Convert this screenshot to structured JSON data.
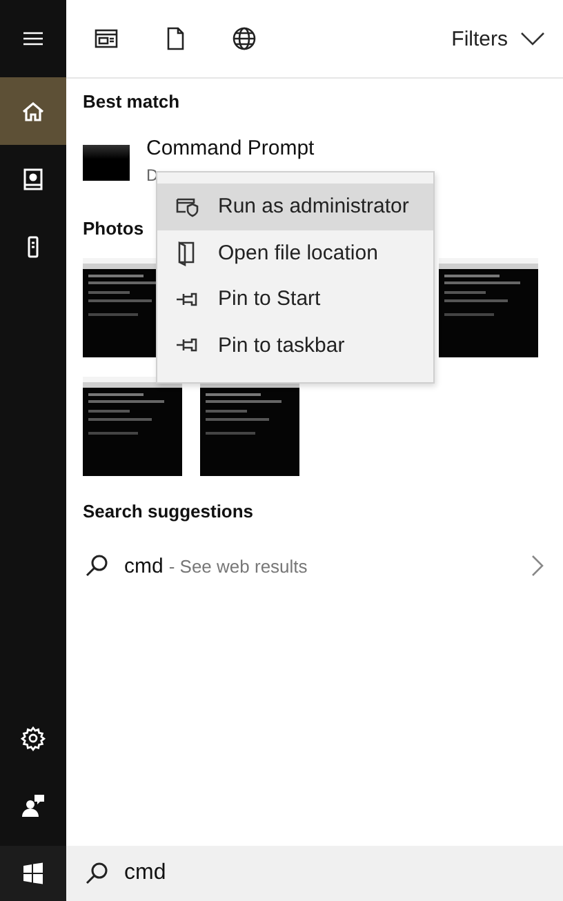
{
  "sidebar": {
    "items": [
      {
        "kind": "menu",
        "selected": false
      },
      {
        "kind": "home",
        "selected": true
      },
      {
        "kind": "notebook",
        "selected": false
      },
      {
        "kind": "device",
        "selected": false
      }
    ],
    "bottom_items": [
      {
        "kind": "settings"
      },
      {
        "kind": "feedback"
      }
    ]
  },
  "top_bar": {
    "tabs": [
      {
        "kind": "apps"
      },
      {
        "kind": "documents"
      },
      {
        "kind": "web"
      }
    ],
    "filters": "Filters"
  },
  "best_match": {
    "heading": "Best match",
    "title": "Command Prompt",
    "subtitle": "D"
  },
  "context_menu": {
    "items": [
      {
        "kind": "admin",
        "label": "Run as administrator",
        "selected": true
      },
      {
        "kind": "folder",
        "label": "Open file location",
        "selected": false
      },
      {
        "kind": "pin",
        "label": "Pin to Start",
        "selected": false
      },
      {
        "kind": "pin",
        "label": "Pin to taskbar",
        "selected": false
      }
    ]
  },
  "photos": {
    "heading": "Photos"
  },
  "search_suggestions": {
    "heading": "Search suggestions",
    "query": "cmd",
    "hint": "- See web results"
  },
  "search_box": {
    "value": "cmd"
  }
}
